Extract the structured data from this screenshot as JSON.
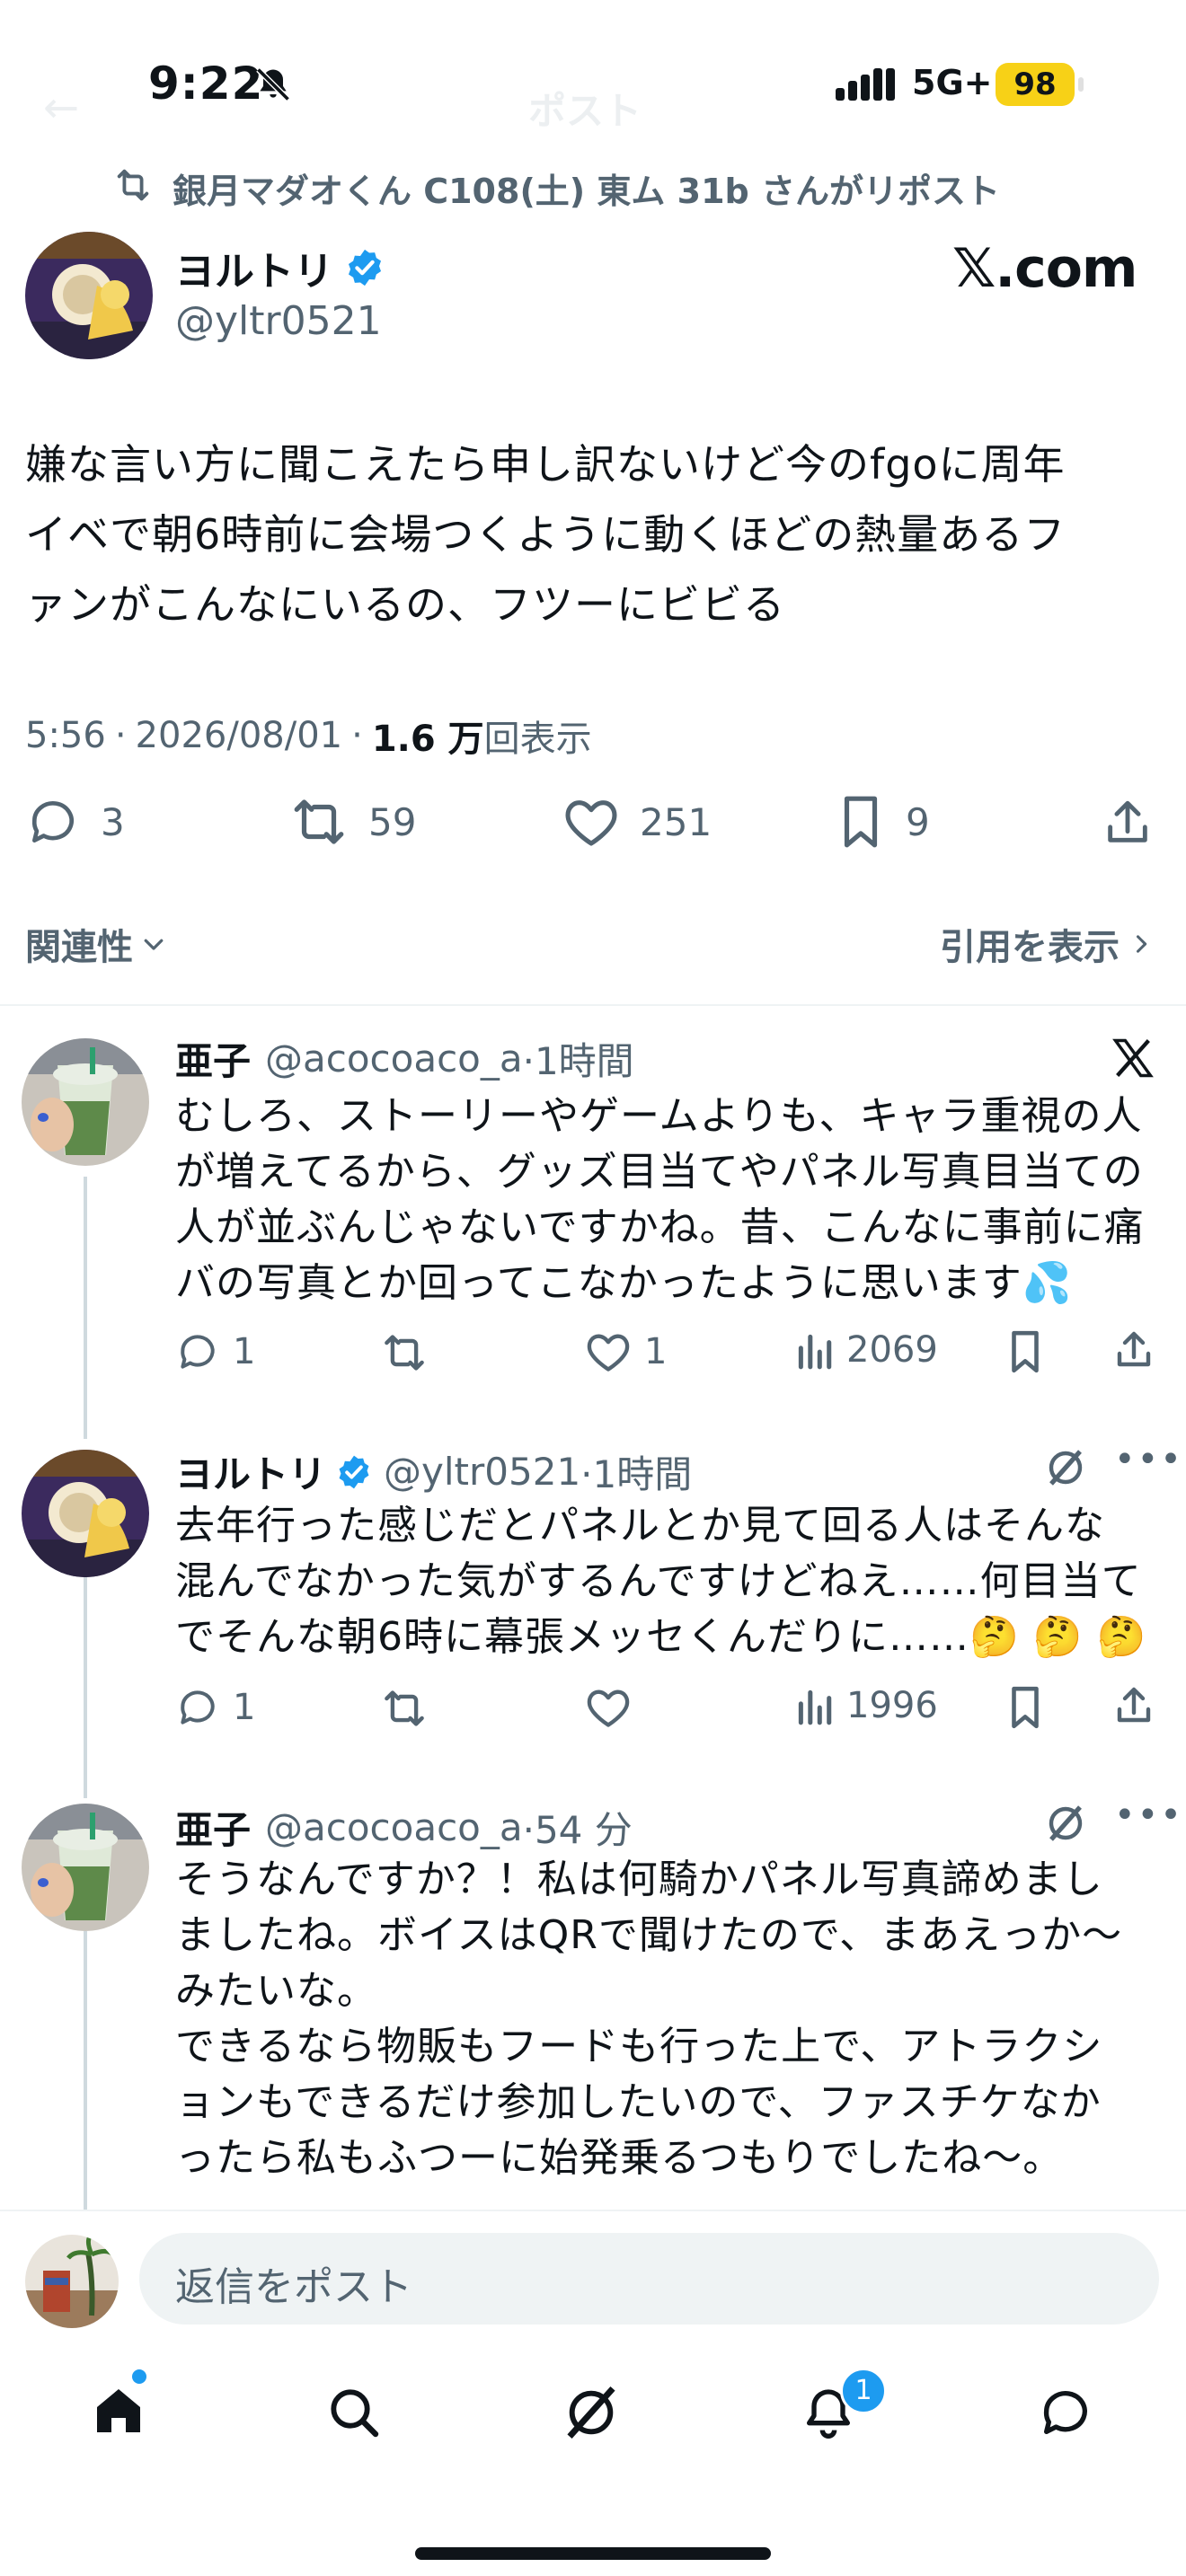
{
  "status_bar": {
    "time": "9:22",
    "network": "5G+",
    "battery": "98"
  },
  "header": {
    "back_label": "←",
    "title": "ポスト"
  },
  "repost_context": "銀月マダオくん C108(土) 東ム 31b さんがリポスト",
  "main_post": {
    "name": "ヨルトリ",
    "handle": "@yltr0521",
    "brand": "𝕏.com",
    "text_lines": [
      "嫌な言い方に聞こえたら申し訳ないけど今のfgoに周年",
      "イベで朝6時前に会場つくように動くほどの熱量あるフ",
      "ァンがこんなにいるの、フツーにビビる"
    ],
    "time": "5:56",
    "date": "2026/08/01",
    "views_value": "1.6 万",
    "views_label": "回表示",
    "dot": "·",
    "actions": {
      "replies": "3",
      "reposts": "59",
      "likes": "251",
      "bookmarks": "9"
    }
  },
  "filters": {
    "relevance": "関連性",
    "quotes": "引用を表示"
  },
  "replies": [
    {
      "name": "亜子",
      "handle": "@acocoaco_a",
      "time": "·1時間",
      "lines": [
        "むしろ、ストーリーやゲームよりも、キャラ重視の人",
        "が増えてるから、グッズ目当てやパネル写真目当ての",
        "人が並ぶんじゃないですかね。昔、こんなに事前に痛",
        "バの写真とか回ってこなかったように思います💦"
      ],
      "replies": "1",
      "reposts": "",
      "likes": "1",
      "views": "2069"
    },
    {
      "name": "ヨルトリ",
      "handle": "@yltr0521",
      "time": "·1時間",
      "lines": [
        "去年行った感じだとパネルとか見て回る人はそんな",
        "混んでなかった気がするんですけどねえ……何目当て",
        "でそんな朝6時に幕張メッセくんだりに……🤔 🤔 🤔"
      ],
      "replies": "1",
      "reposts": "",
      "likes": "",
      "views": "1996"
    },
    {
      "name": "亜子",
      "handle": "@acocoaco_a",
      "time": "·54 分",
      "lines": [
        "そうなんですか？！私は何騎かパネル写真諦めまし",
        "ましたね。ボイスはQRで聞けたので、まあえっか〜",
        "みたいな。",
        "できるなら物販もフードも行った上で、アトラクシ",
        "ョンもできるだけ参加したいので、ファスチケなか",
        "ったら私もふつーに始発乗るつもりでしたね〜。"
      ]
    }
  ],
  "reply_box": {
    "placeholder": "返信をポスト"
  },
  "tab_bar": {
    "notifications_badge": "1"
  },
  "colors": {
    "accent": "#1d9bf0",
    "text": "#0f1419",
    "muted": "#536471",
    "battery": "#f7d117"
  }
}
